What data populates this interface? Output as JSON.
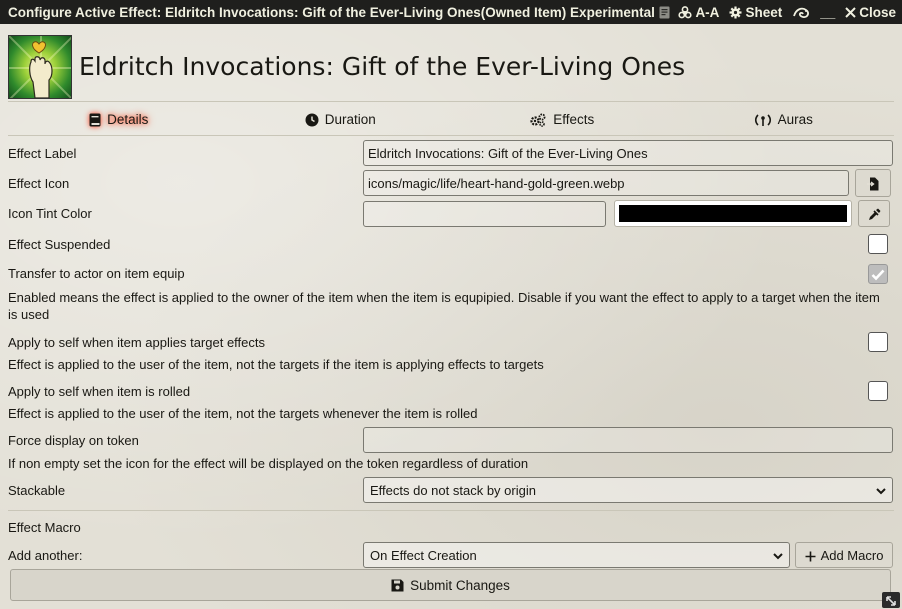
{
  "window": {
    "title": "Configure Active Effect: Eldritch Invocations: Gift of the Ever-Living Ones(Owned Item) Experimental",
    "controls": {
      "aa_label": "A-A",
      "sheet_label": "Sheet",
      "minimize_label": "__",
      "close_label": "Close"
    }
  },
  "header": {
    "effect_name": "Eldritch Invocations: Gift of the Ever-Living Ones",
    "image_icon": "heart-hand-gold-green-icon"
  },
  "tabs": [
    {
      "label": "Details",
      "icon": "book-icon",
      "active": true
    },
    {
      "label": "Duration",
      "icon": "clock-icon",
      "active": false
    },
    {
      "label": "Effects",
      "icon": "cogs-icon",
      "active": false
    },
    {
      "label": "Auras",
      "icon": "broadcast-icon",
      "active": false
    }
  ],
  "form": {
    "effect_label": {
      "label": "Effect Label",
      "value": "Eldritch Invocations: Gift of the Ever-Living Ones"
    },
    "effect_icon": {
      "label": "Effect Icon",
      "value": "icons/magic/life/heart-hand-gold-green.webp"
    },
    "icon_tint": {
      "label": "Icon Tint Color",
      "value": "",
      "swatch_color": "#000000"
    },
    "effect_suspended": {
      "label": "Effect Suspended",
      "checked": false
    },
    "transfer": {
      "label": "Transfer to actor on item equip",
      "checked": true,
      "hint": "Enabled means the effect is applied to the owner of the item when the item is equpipied. Disable if you want the effect to apply to a target when the item is used"
    },
    "apply_self_target": {
      "label": "Apply to self when item applies target effects",
      "checked": false,
      "hint": "Effect is applied to the user of the item, not the targets if the item is applying effects to targets"
    },
    "apply_self_rolled": {
      "label": "Apply to self when item is rolled",
      "checked": false,
      "hint": "Effect is applied to the user of the item, not the targets whenever the item is rolled"
    },
    "force_display": {
      "label": "Force display on token",
      "value": "",
      "hint": "If non empty set the icon for the effect will be displayed on the token regardless of duration"
    },
    "stackable": {
      "label": "Stackable",
      "selected": "Effects do not stack by origin"
    },
    "effect_macro": {
      "label": "Effect Macro"
    },
    "add_another": {
      "label": "Add another:",
      "selected": "On Effect Creation",
      "button_label": "Add Macro"
    }
  },
  "submit": {
    "label": "Submit Changes"
  }
}
